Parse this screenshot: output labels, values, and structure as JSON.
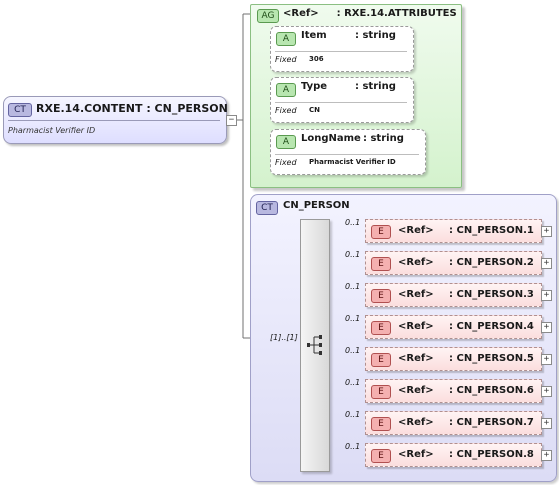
{
  "root": {
    "badge": "CT",
    "title": "RXE.14.CONTENT : CN_PERSON",
    "documentation": "Pharmacist Verifier ID",
    "toggle": "−"
  },
  "attribute_group": {
    "badge": "AG",
    "ref": "<Ref>",
    "name": ": RXE.14.ATTRIBUTES",
    "attributes": [
      {
        "badge": "A",
        "name": "Item",
        "type": ": string",
        "fixed_label": "Fixed",
        "fixed_value": "306"
      },
      {
        "badge": "A",
        "name": "Type",
        "type": ": string",
        "fixed_label": "Fixed",
        "fixed_value": "CN"
      },
      {
        "badge": "A",
        "name": "LongName",
        "type": ": string",
        "fixed_label": "Fixed",
        "fixed_value": "Pharmacist Verifier ID"
      }
    ]
  },
  "complex_type": {
    "badge": "CT",
    "title": "CN_PERSON",
    "sequence_cardinality": "[1]..[1]",
    "elements": [
      {
        "badge": "E",
        "ref": "<Ref>",
        "name": ": CN_PERSON.1",
        "cardinality": "0..1",
        "toggle": "+"
      },
      {
        "badge": "E",
        "ref": "<Ref>",
        "name": ": CN_PERSON.2",
        "cardinality": "0..1",
        "toggle": "+"
      },
      {
        "badge": "E",
        "ref": "<Ref>",
        "name": ": CN_PERSON.3",
        "cardinality": "0..1",
        "toggle": "+"
      },
      {
        "badge": "E",
        "ref": "<Ref>",
        "name": ": CN_PERSON.4",
        "cardinality": "0..1",
        "toggle": "+"
      },
      {
        "badge": "E",
        "ref": "<Ref>",
        "name": ": CN_PERSON.5",
        "cardinality": "0..1",
        "toggle": "+"
      },
      {
        "badge": "E",
        "ref": "<Ref>",
        "name": ": CN_PERSON.6",
        "cardinality": "0..1",
        "toggle": "+"
      },
      {
        "badge": "E",
        "ref": "<Ref>",
        "name": ": CN_PERSON.7",
        "cardinality": "0..1",
        "toggle": "+"
      },
      {
        "badge": "E",
        "ref": "<Ref>",
        "name": ": CN_PERSON.8",
        "cardinality": "0..1",
        "toggle": "+"
      }
    ]
  }
}
